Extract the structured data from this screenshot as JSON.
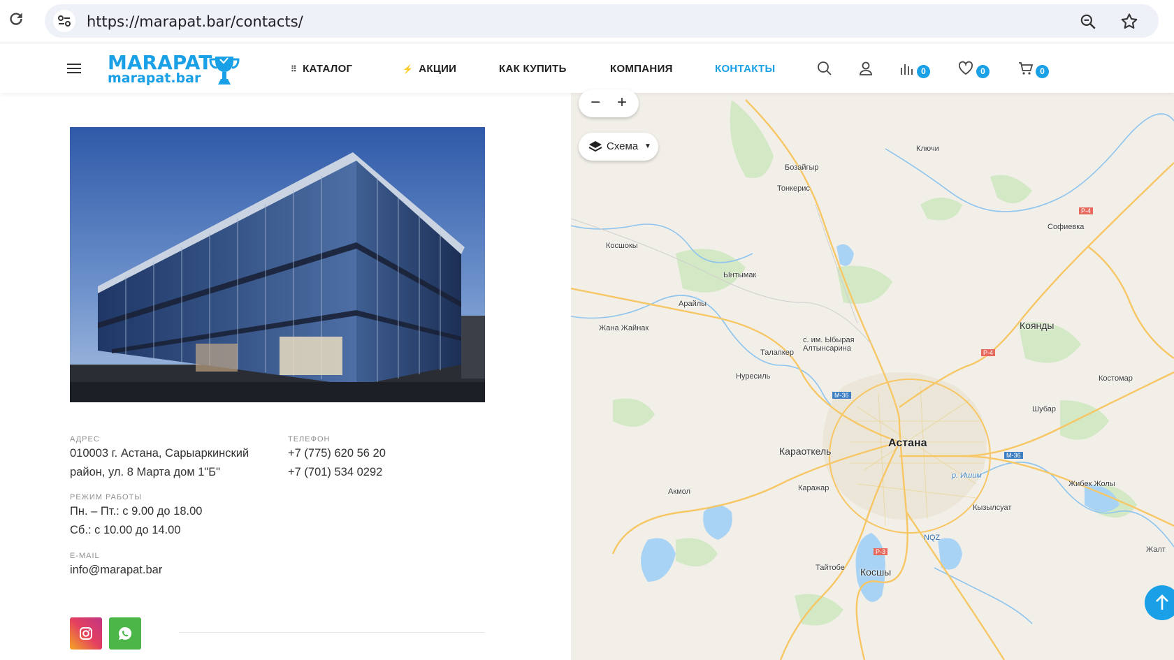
{
  "browser": {
    "url": "https://marapat.bar/contacts/"
  },
  "header": {
    "logo_main": "MARAPAT",
    "logo_sub": "marapat.bar",
    "nav": [
      {
        "label": "КАТАЛОГ"
      },
      {
        "label": "АКЦИИ"
      },
      {
        "label": "КАК КУПИТЬ"
      },
      {
        "label": "КОМПАНИЯ"
      },
      {
        "label": "КОНТАКТЫ",
        "active": true
      }
    ],
    "compare_count": "0",
    "favorites_count": "0",
    "cart_count": "0",
    "accent_color": "#1aa0e6",
    "icons": [
      "menu-icon",
      "grid-icon",
      "bolt-icon",
      "search-icon",
      "user-icon",
      "compare-icon",
      "heart-icon",
      "cart-icon"
    ]
  },
  "contacts": {
    "address_label": "АДРЕС",
    "address_line1": "010003 г. Астана, Сарыаркинский",
    "address_line2": "район, ул. 8 Марта дом 1\"Б\"",
    "phone_label": "ТЕЛЕФОН",
    "phone1": "+7 (775) 620 56 20",
    "phone2": "+7 (701) 534 0292",
    "hours_label": "РЕЖИМ РАБОТЫ",
    "hours1": "Пн. – Пт.: с 9.00 до 18.00",
    "hours2": "Сб.: с 10.00 до 14.00",
    "email_label": "E-MAIL",
    "email": "info@marapat.bar",
    "social": [
      "instagram-icon",
      "whatsapp-icon"
    ]
  },
  "map": {
    "zoom_out": "−",
    "zoom_in": "+",
    "layer_label": "Схема",
    "places": {
      "klyuchi": "Ключи",
      "bozaigyr": "Бозайгыр",
      "tonkeris": "Тонкерис",
      "sofievka": "Софиевка",
      "koshoky": "Косшокы",
      "yntymak": "Ынтымак",
      "arayly": "Арайлы",
      "zhana_zhainak": "Жана Жайнак",
      "koyandy": "Коянды",
      "altynsarina": "с. им. Ыбырая\nАлтынсарина",
      "talapker": "Талапкер",
      "kostomar": "Костомар",
      "nuresil": "Нуресиль",
      "shubar": "Шубар",
      "karaotkel": "Караоткель",
      "astana": "Астана",
      "akmol": "Акмол",
      "karazhar": "Каражар",
      "zhibek_zholy": "Жибек Жолы",
      "kyzylsuat": "Кызылсуат",
      "nqz": "NQZ",
      "taitobe": "Тайтобе",
      "kosshy": "Косшы",
      "zhal": "Жалт",
      "ishim": "р. Ишим"
    },
    "road_labels": {
      "p4a": "Р-4",
      "p4b": "Р-4",
      "m36a": "М-36",
      "m36b": "М-36",
      "p3": "Р-3"
    }
  }
}
